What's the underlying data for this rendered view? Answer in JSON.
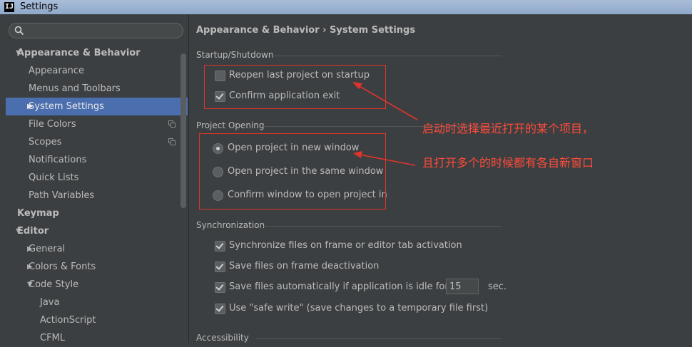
{
  "window": {
    "logo": "IJ",
    "title": "Settings"
  },
  "sidebar": {
    "search": {
      "value": "",
      "placeholder": ""
    },
    "tree": [
      {
        "label": "Appearance & Behavior",
        "bold": true,
        "arrow": "down",
        "level": 0
      },
      {
        "label": "Appearance",
        "level": 1
      },
      {
        "label": "Menus and Toolbars",
        "level": 1
      },
      {
        "label": "System Settings",
        "level": 1,
        "arrow": "right",
        "selected": true
      },
      {
        "label": "File Colors",
        "level": 1,
        "icon": "copy-icon"
      },
      {
        "label": "Scopes",
        "level": 1,
        "icon": "copy-icon"
      },
      {
        "label": "Notifications",
        "level": 1
      },
      {
        "label": "Quick Lists",
        "level": 1
      },
      {
        "label": "Path Variables",
        "level": 1
      },
      {
        "label": "Keymap",
        "bold": true,
        "level": 0
      },
      {
        "label": "Editor",
        "bold": true,
        "arrow": "down",
        "level": 0
      },
      {
        "label": "General",
        "level": 1,
        "arrow": "right"
      },
      {
        "label": "Colors & Fonts",
        "level": 1,
        "arrow": "right"
      },
      {
        "label": "Code Style",
        "level": 1,
        "arrow": "down"
      },
      {
        "label": "Java",
        "level": 2
      },
      {
        "label": "ActionScript",
        "level": 2
      },
      {
        "label": "CFML",
        "level": 2
      }
    ]
  },
  "main": {
    "breadcrumb": "Appearance & Behavior › System Settings",
    "startup": {
      "title": "Startup/Shutdown",
      "reopen_label": "Reopen last project on startup",
      "reopen_checked": false,
      "confirm_exit_label": "Confirm application exit",
      "confirm_exit_checked": true
    },
    "project_opening": {
      "title": "Project Opening",
      "options": [
        {
          "label": "Open project in new window",
          "checked": true
        },
        {
          "label": "Open project in the same window",
          "checked": false
        },
        {
          "label": "Confirm window to open project in",
          "checked": false
        }
      ]
    },
    "sync": {
      "title": "Synchronization",
      "sync_files_label": "Synchronize files on frame or editor tab activation",
      "save_deactivation_label": "Save files on frame deactivation",
      "save_idle_label": "Save files automatically if application is idle for",
      "idle_value": "15",
      "idle_unit": "sec.",
      "safe_write_label": "Use \"safe write\" (save changes to a temporary file first)"
    },
    "accessibility": {
      "title": "Accessibility"
    }
  },
  "annotations": {
    "note1": "启动时选择最近打开的某个项目，",
    "note2": "且打开多个的时候都有各自新窗口",
    "color": "#e0342a"
  }
}
